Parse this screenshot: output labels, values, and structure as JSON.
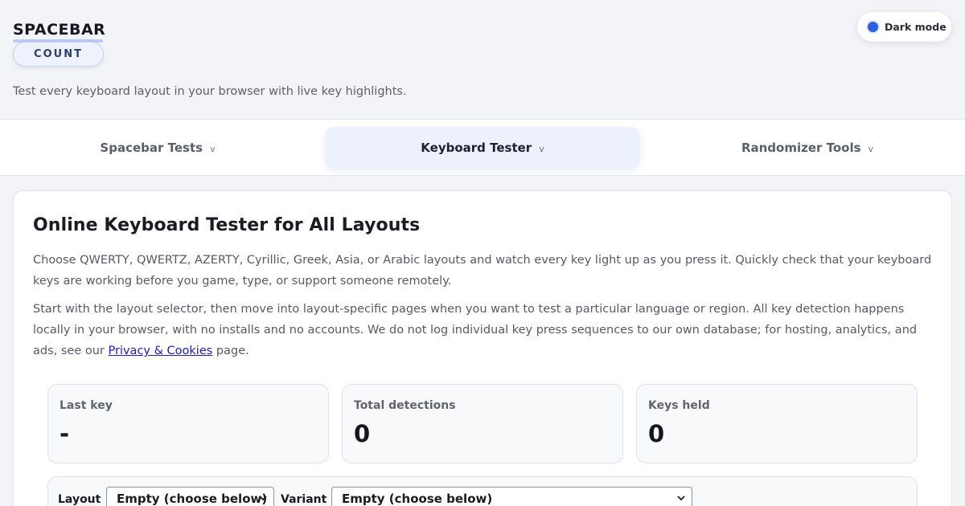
{
  "brand": {
    "top": "SPACEBAR",
    "bottom": "COUNT"
  },
  "tagline": "Test every keyboard layout in your browser with live key highlights.",
  "dark_mode": {
    "label": "Dark mode",
    "accent": "#2b5fe3"
  },
  "nav": {
    "items": [
      {
        "label": "Spacebar Tests",
        "chevron": "v"
      },
      {
        "label": "Keyboard Tester",
        "chevron": "v",
        "active": true
      },
      {
        "label": "Randomizer Tools",
        "chevron": "v"
      }
    ]
  },
  "main": {
    "title": "Online Keyboard Tester for All Layouts",
    "para1": "Choose QWERTY, QWERTZ, AZERTY, Cyrillic, Greek, Asia, or Arabic layouts and watch every key light up as you press it. Quickly check that your keyboard keys are working before you game, type, or support someone remotely.",
    "para2_before": "Start with the layout selector, then move into layout-specific pages when you want to test a particular language or region. All key detection happens locally in your browser, with no installs and no accounts. We do not log individual key press sequences to our own database; for hosting, analytics, and ads, see our ",
    "para2_link": "Privacy & Cookies",
    "para2_after": " page."
  },
  "stats": [
    {
      "label": "Last key",
      "value": "-"
    },
    {
      "label": "Total detections",
      "value": "0"
    },
    {
      "label": "Keys held",
      "value": "0"
    }
  ],
  "controls": {
    "layout_label": "Layout",
    "layout_value": "Empty (choose below)",
    "variant_label": "Variant",
    "variant_value": "Empty (choose below)"
  }
}
